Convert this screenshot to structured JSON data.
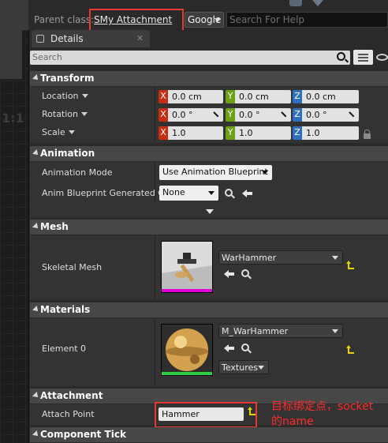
{
  "toolbar": {
    "parent_class_label": "Parent class:",
    "parent_class_value": "SMy Attachment",
    "search_provider": "Google",
    "help_search_placeholder": "Search For Help"
  },
  "canvas": {
    "edge_text": "1:1"
  },
  "tab": {
    "label": "Details",
    "close": "✕"
  },
  "details_search": {
    "placeholder": "Search"
  },
  "transform": {
    "title": "Transform",
    "rows": [
      {
        "label": "Location",
        "x": "0.0 cm",
        "y": "0.0 cm",
        "z": "0.0 cm"
      },
      {
        "label": "Rotation",
        "x": "0.0 °",
        "y": "0.0 °",
        "z": "0.0 °"
      },
      {
        "label": "Scale",
        "x": "1.0",
        "y": "1.0",
        "z": "1.0"
      }
    ],
    "axis_x": "X",
    "axis_y": "Y",
    "axis_z": "Z"
  },
  "animation": {
    "title": "Animation",
    "mode_label": "Animation Mode",
    "mode_value": "Use Animation Blueprint",
    "anim_bp_label": "Anim Blueprint Generated Cl",
    "anim_bp_value": "None"
  },
  "mesh": {
    "title": "Mesh",
    "skeletal_label": "Skeletal Mesh",
    "skeletal_value": "WarHammer"
  },
  "materials": {
    "title": "Materials",
    "element_label": "Element 0",
    "element_value": "M_WarHammer",
    "textures_label": "Textures"
  },
  "attachment": {
    "title": "Attachment",
    "point_label": "Attach Point",
    "point_value": "Hammer"
  },
  "component_tick": {
    "title": "Component Tick"
  },
  "annotation": {
    "line1": "目标绑定点，socket",
    "line2": "的name"
  },
  "colors": {
    "highlight": "#e53935",
    "axis_x": "#c62e14",
    "axis_y": "#6ea015",
    "axis_z": "#2d6fc0",
    "reset_arrow": "#e5d400"
  }
}
